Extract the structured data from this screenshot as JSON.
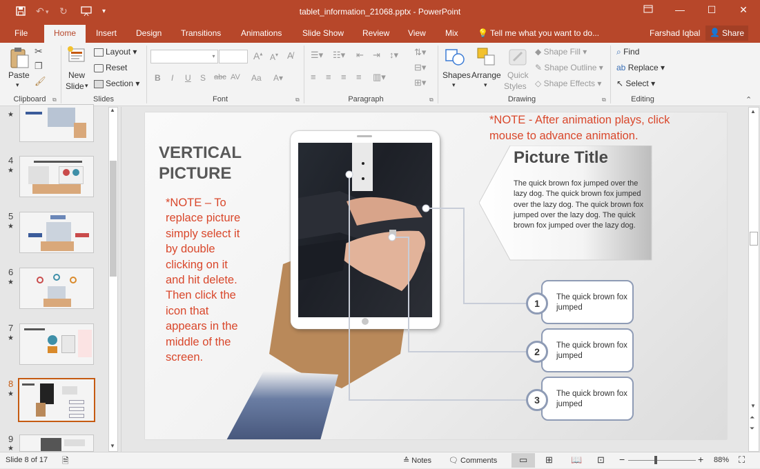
{
  "title_bar": {
    "document_title": "tablet_information_21068.pptx - PowerPoint"
  },
  "tabs": {
    "file": "File",
    "home": "Home",
    "insert": "Insert",
    "design": "Design",
    "transitions": "Transitions",
    "animations": "Animations",
    "slide_show": "Slide Show",
    "review": "Review",
    "view": "View",
    "mix": "Mix",
    "tell_me": "Tell me what you want to do...",
    "user": "Farshad Iqbal",
    "share": "Share"
  },
  "ribbon": {
    "clipboard": {
      "paste": "Paste",
      "label": "Clipboard"
    },
    "slides": {
      "new_slide_1": "New",
      "new_slide_2": "Slide",
      "layout": "Layout",
      "reset": "Reset",
      "section": "Section",
      "label": "Slides"
    },
    "font": {
      "label": "Font",
      "bold": "B",
      "italic": "I",
      "underline": "U",
      "shadow": "S",
      "strike": "abc",
      "spacing": "AV",
      "case": "Aa",
      "grow": "A",
      "shrink": "A"
    },
    "paragraph": {
      "label": "Paragraph"
    },
    "drawing": {
      "shapes": "Shapes",
      "arrange": "Arrange",
      "quick_styles_1": "Quick",
      "quick_styles_2": "Styles",
      "shape_fill": "Shape Fill",
      "shape_outline": "Shape Outline",
      "shape_effects": "Shape Effects",
      "label": "Drawing"
    },
    "editing": {
      "find": "Find",
      "replace": "Replace",
      "select": "Select",
      "label": "Editing"
    }
  },
  "thumbnails": {
    "numbers": [
      "4",
      "5",
      "6",
      "7",
      "8",
      "9"
    ],
    "selected": "8"
  },
  "slide": {
    "heading_line1": "VERTICAL",
    "heading_line2": "PICTURE",
    "note_left": "*NOTE – To replace picture simply select it by double clicking on it and hit delete.  Then click the icon that appears in the middle of the screen.",
    "note_top": "*NOTE - After animation plays, click mouse to advance animation.",
    "callout_title": "Picture Title",
    "callout_body": "The quick brown fox jumped over the lazy dog. The quick brown fox jumped over the lazy dog. The quick brown fox jumped over the lazy dog. The quick brown fox jumped over the lazy dog.",
    "items": [
      {
        "num": "1",
        "text": "The quick brown fox jumped"
      },
      {
        "num": "2",
        "text": "The quick brown fox jumped"
      },
      {
        "num": "3",
        "text": "The quick brown fox jumped"
      }
    ]
  },
  "status_bar": {
    "slide_info": "Slide 8 of 17",
    "notes": "Notes",
    "comments": "Comments",
    "zoom": "88%"
  },
  "colors": {
    "accent": "#b7472a",
    "note_red": "#d9472b",
    "selected_thumb": "#c55a11"
  }
}
